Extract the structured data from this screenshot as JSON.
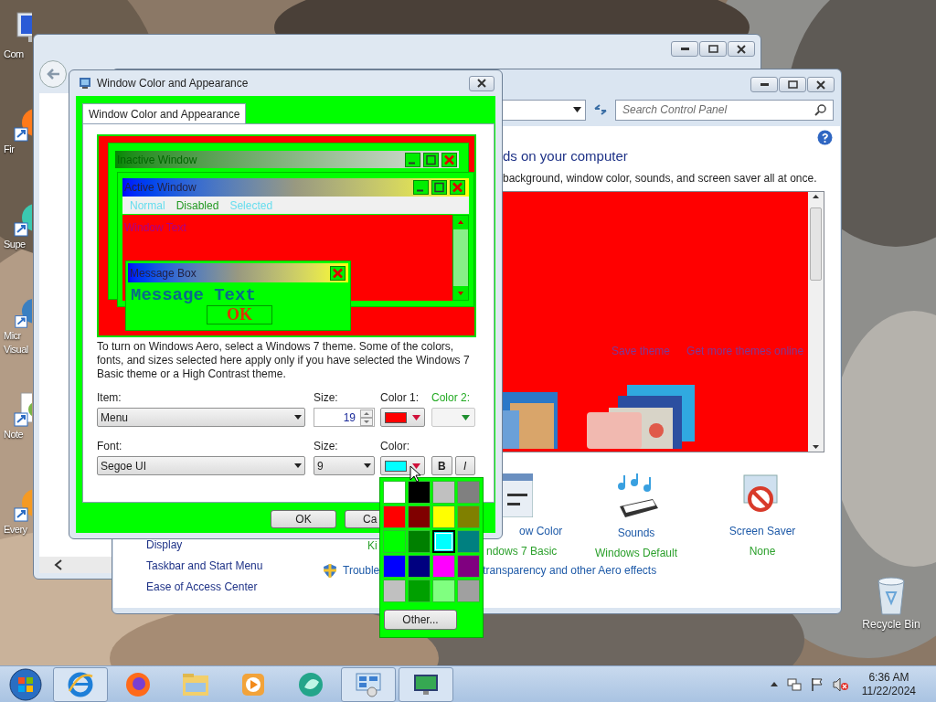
{
  "desktop_icons": [
    {
      "kind": "computer",
      "lines": [
        "Com"
      ]
    },
    {
      "kind": "firefox",
      "lines": [
        "Fir"
      ]
    },
    {
      "kind": "teal",
      "lines": [
        "Supe"
      ]
    },
    {
      "kind": "edge",
      "lines": [
        "Micr",
        "Visual"
      ]
    },
    {
      "kind": "notepad",
      "lines": [
        "Note"
      ]
    },
    {
      "kind": "orange",
      "lines": [
        "Every"
      ]
    }
  ],
  "recycle_bin": {
    "label": "Recycle Bin"
  },
  "control_panel": {
    "search": {
      "placeholder": "Search Control Panel"
    },
    "heading": "ds on your computer",
    "subtitle": "background, window color, sounds, and screen saver all at once.",
    "theme_links": [
      "Save theme",
      "Get more themes online"
    ],
    "nav": [
      "Display",
      "Taskbar and Start Menu",
      "Ease of Access Center"
    ],
    "settings": [
      {
        "kind": "window",
        "title": "ow Color",
        "value": "ndows 7 Basic"
      },
      {
        "kind": "sounds",
        "title": "Sounds",
        "value": "Windows Default"
      },
      {
        "kind": "screensaver",
        "title": "Screen Saver",
        "value": "None"
      }
    ],
    "covered_value": "Ki",
    "trouble_link": "Trouble",
    "aero_link": "transparency and other Aero effects"
  },
  "dialog": {
    "title": "Window Color and Appearance",
    "tab": "Window Color and Appearance",
    "preview": {
      "inactive_title": "Inactive Window",
      "active_title": "Active Window",
      "menu": [
        "Normal",
        "Disabled",
        "Selected"
      ],
      "window_text": "Window Text",
      "message_title": "Message Box",
      "message_text": "Message Text",
      "ok": "OK"
    },
    "description": "To turn on Windows Aero, select a Windows 7 theme.  Some of the colors, fonts, and sizes selected here apply only if you have selected the Windows 7 Basic theme or a High Contrast theme.",
    "item": {
      "label": "Item:",
      "value": "Menu"
    },
    "item_size": {
      "label": "Size:",
      "value": "19"
    },
    "color1": {
      "label": "Color 1:",
      "color": "#ff0000"
    },
    "color2": {
      "label": "Color 2:",
      "disabled": true
    },
    "font": {
      "label": "Font:",
      "value": "Segoe UI"
    },
    "font_size": {
      "label": "Size:",
      "value": "9"
    },
    "font_color": {
      "label": "Color:",
      "color": "#00ffff"
    },
    "bold": {
      "label": "B",
      "on": false
    },
    "italic": {
      "label": "I",
      "on": false
    },
    "buttons": [
      "OK",
      "Ca"
    ]
  },
  "palette": {
    "colors": [
      {
        "color": "#ffffff",
        "selected": false
      },
      {
        "color": "#000000",
        "selected": false
      },
      {
        "color": "#c0c0c0",
        "selected": false
      },
      {
        "color": "#808080",
        "selected": false
      },
      {
        "color": "#ff0000",
        "selected": false
      },
      {
        "color": "#800000",
        "selected": false
      },
      {
        "color": "#ffff00",
        "selected": false
      },
      {
        "color": "#808000",
        "selected": false
      },
      {
        "color": "#00ff00",
        "selected": false
      },
      {
        "color": "#008000",
        "selected": false
      },
      {
        "color": "#00ffff",
        "selected": true
      },
      {
        "color": "#008080",
        "selected": false
      },
      {
        "color": "#0000ff",
        "selected": false
      },
      {
        "color": "#000080",
        "selected": false
      },
      {
        "color": "#ff00ff",
        "selected": false
      },
      {
        "color": "#800080",
        "selected": false
      },
      {
        "color": "#c0c0c0",
        "selected": false
      },
      {
        "color": "#00a000",
        "selected": false
      },
      {
        "color": "#80ff80",
        "selected": false
      },
      {
        "color": "#a0a0a0",
        "selected": false
      }
    ],
    "other": "Other..."
  },
  "taskbar": {
    "apps": [
      {
        "kind": "ie",
        "open": true
      },
      {
        "kind": "firefox",
        "open": false
      },
      {
        "kind": "explorer",
        "open": false
      },
      {
        "kind": "media",
        "open": false
      },
      {
        "kind": "teal",
        "open": false
      },
      {
        "kind": "controlpanel",
        "open": true
      },
      {
        "kind": "display",
        "open": true
      }
    ],
    "time": "6:36 AM",
    "date": "11/22/2024"
  }
}
